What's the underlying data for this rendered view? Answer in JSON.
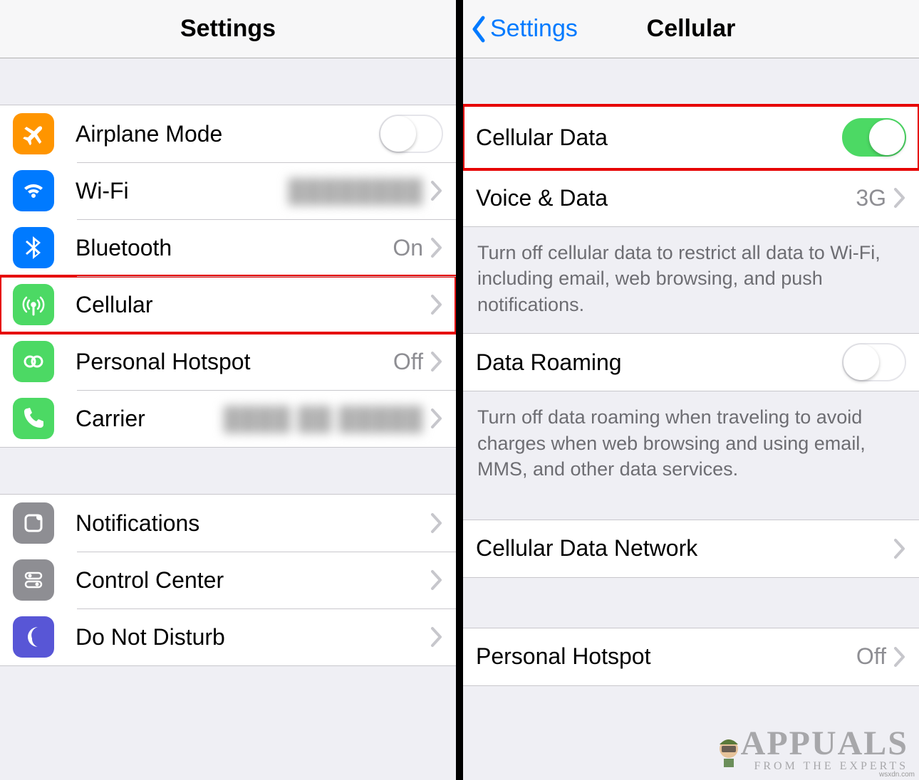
{
  "left": {
    "title": "Settings",
    "group1": {
      "airplane": {
        "label": "Airplane Mode",
        "on": false
      },
      "wifi": {
        "label": "Wi-Fi",
        "value": ""
      },
      "bluetooth": {
        "label": "Bluetooth",
        "value": "On"
      },
      "cellular": {
        "label": "Cellular"
      },
      "hotspot": {
        "label": "Personal Hotspot",
        "value": "Off"
      },
      "carrier": {
        "label": "Carrier",
        "value": ""
      }
    },
    "group2": {
      "notifications": {
        "label": "Notifications"
      },
      "controlcenter": {
        "label": "Control Center"
      },
      "dnd": {
        "label": "Do Not Disturb"
      }
    }
  },
  "right": {
    "back": "Settings",
    "title": "Cellular",
    "group1": {
      "cellulardata": {
        "label": "Cellular Data",
        "on": true
      },
      "voicedata": {
        "label": "Voice & Data",
        "value": "3G"
      },
      "footer": "Turn off cellular data to restrict all data to Wi-Fi, including email, web browsing, and push notifications."
    },
    "group2": {
      "roaming": {
        "label": "Data Roaming",
        "on": false
      },
      "footer": "Turn off data roaming when traveling to avoid charges when web browsing and using email, MMS, and other data services."
    },
    "group3": {
      "network": {
        "label": "Cellular Data Network"
      }
    },
    "group4": {
      "hotspot": {
        "label": "Personal Hotspot",
        "value": "Off"
      }
    }
  },
  "watermark": {
    "brand": "APPUALS",
    "tagline": "FROM THE EXPERTS",
    "source": "wsxdn.com"
  }
}
